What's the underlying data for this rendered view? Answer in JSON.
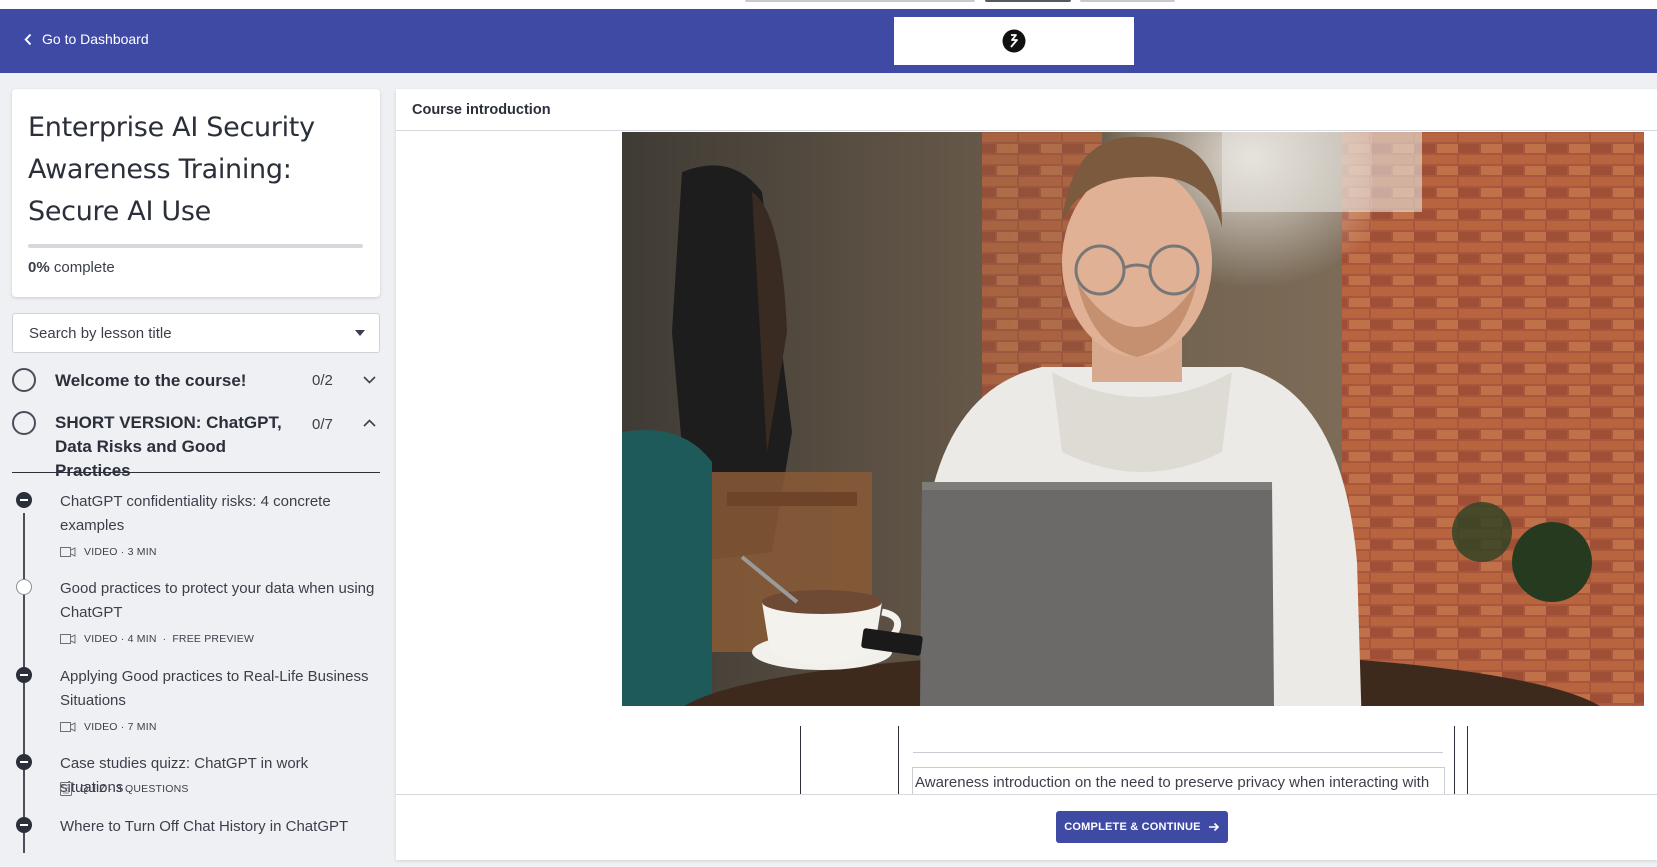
{
  "header": {
    "back_label": "Go to Dashboard",
    "brand_color": "#3f4aa5"
  },
  "course": {
    "title": "Enterprise AI Security Awareness Training: Secure AI Use",
    "progress_percent": 0,
    "progress_value": "0%",
    "progress_suffix": "complete"
  },
  "search": {
    "placeholder": "Search by lesson title"
  },
  "sections": [
    {
      "title": "Welcome to the course!",
      "count": "0/2",
      "expanded": false
    },
    {
      "title": "SHORT VERSION: ChatGPT, Data Risks and Good Practices",
      "count": "0/7",
      "expanded": true
    }
  ],
  "lessons": [
    {
      "title": "ChatGPT confidentiality risks: 4 concrete examples",
      "meta": "VIDEO · 3 MIN",
      "icon": "video-icon",
      "status": "in-progress"
    },
    {
      "title": "Good practices to protect your data when using ChatGPT",
      "meta": "VIDEO · 4 MIN",
      "extra": "FREE PREVIEW",
      "icon": "video-icon",
      "status": "current"
    },
    {
      "title": "Applying Good practices to Real-Life Business Situations",
      "meta": "VIDEO · 7 MIN",
      "icon": "video-icon",
      "status": "in-progress"
    },
    {
      "title": "Case studies quizz: ChatGPT in work situations",
      "meta": "QUIZ · 3 QUESTIONS",
      "icon": "quiz-icon",
      "status": "in-progress"
    },
    {
      "title": "Where to Turn Off Chat History in ChatGPT",
      "status": "in-progress"
    }
  ],
  "main": {
    "heading": "Course introduction",
    "description": "Awareness introduction on the need to preserve privacy when interacting with",
    "cta_label": "COMPLETE & CONTINUE"
  }
}
